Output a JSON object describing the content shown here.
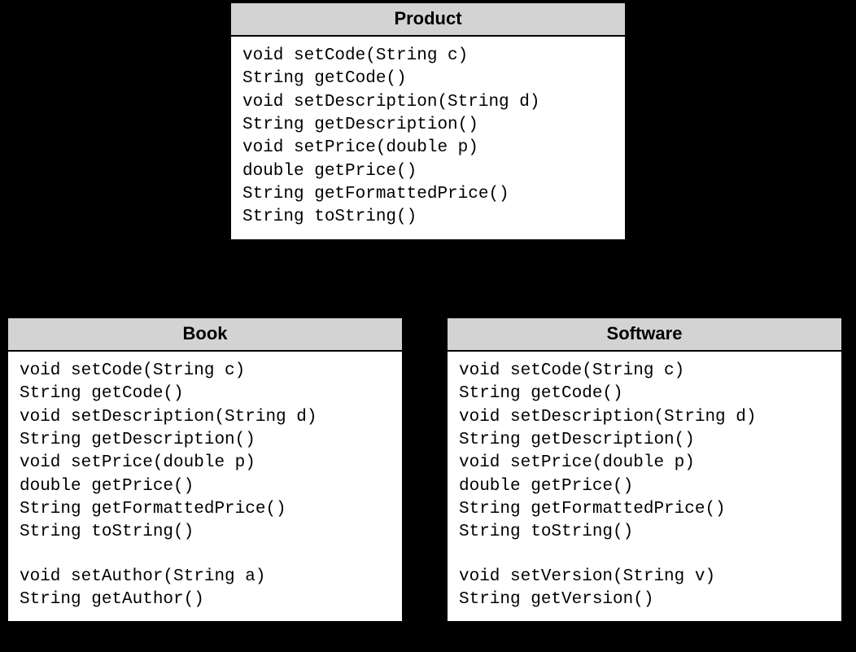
{
  "classes": {
    "product": {
      "name": "Product",
      "methods": [
        "void setCode(String c)",
        "String getCode()",
        "void setDescription(String d)",
        "String getDescription()",
        "void setPrice(double p)",
        "double getPrice()",
        "String getFormattedPrice()",
        "String toString()"
      ]
    },
    "book": {
      "name": "Book",
      "methods": [
        "void setCode(String c)",
        "String getCode()",
        "void setDescription(String d)",
        "String getDescription()",
        "void setPrice(double p)",
        "double getPrice()",
        "String getFormattedPrice()",
        "String toString()"
      ],
      "extra_methods": [
        "void setAuthor(String a)",
        "String getAuthor()"
      ]
    },
    "software": {
      "name": "Software",
      "methods": [
        "void setCode(String c)",
        "String getCode()",
        "void setDescription(String d)",
        "String getDescription()",
        "void setPrice(double p)",
        "double getPrice()",
        "String getFormattedPrice()",
        "String toString()"
      ],
      "extra_methods": [
        "void setVersion(String v)",
        "String getVersion()"
      ]
    }
  }
}
